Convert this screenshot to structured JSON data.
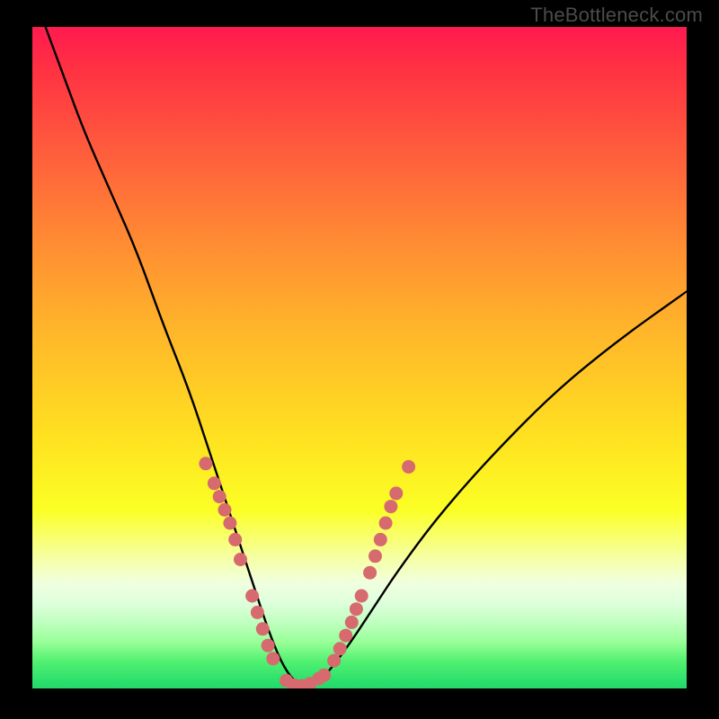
{
  "watermark": "TheBottleneck.com",
  "chart_data": {
    "type": "line",
    "title": "",
    "xlabel": "",
    "ylabel": "",
    "xlim": [
      0,
      100
    ],
    "ylim": [
      0,
      100
    ],
    "grid": false,
    "series": [
      {
        "name": "bottleneck-curve",
        "x": [
          2,
          5,
          8,
          12,
          16,
          20,
          24,
          27,
          30,
          32,
          34,
          36,
          38,
          40,
          42,
          44,
          48,
          52,
          56,
          62,
          70,
          80,
          90,
          100
        ],
        "y": [
          100,
          92,
          84,
          75,
          66,
          55,
          45,
          36,
          27,
          21,
          15,
          9,
          4,
          1,
          0.3,
          1,
          6,
          12,
          18,
          26,
          35,
          45,
          53,
          60
        ]
      }
    ],
    "zone_band": {
      "y_start_pct": 68,
      "y_end_pct": 100
    },
    "dot_clusters": [
      {
        "name": "left-arm-dots",
        "color": "#d66a6f",
        "points": [
          {
            "x": 26.5,
            "y": 34
          },
          {
            "x": 27.8,
            "y": 31
          },
          {
            "x": 28.6,
            "y": 29
          },
          {
            "x": 29.4,
            "y": 27
          },
          {
            "x": 30.2,
            "y": 25
          },
          {
            "x": 31.0,
            "y": 22.5
          },
          {
            "x": 31.8,
            "y": 19.5
          },
          {
            "x": 33.6,
            "y": 14
          },
          {
            "x": 34.4,
            "y": 11.5
          },
          {
            "x": 35.2,
            "y": 9
          },
          {
            "x": 36.0,
            "y": 6.5
          },
          {
            "x": 36.8,
            "y": 4.5
          },
          {
            "x": 38.8,
            "y": 1.2
          },
          {
            "x": 40.0,
            "y": 0.5
          },
          {
            "x": 41.2,
            "y": 0.4
          },
          {
            "x": 42.4,
            "y": 0.7
          },
          {
            "x": 43.8,
            "y": 1.5
          }
        ]
      },
      {
        "name": "right-arm-dots",
        "color": "#d66a6f",
        "points": [
          {
            "x": 44.6,
            "y": 2.0
          },
          {
            "x": 46.1,
            "y": 4.2
          },
          {
            "x": 47.0,
            "y": 6.0
          },
          {
            "x": 47.9,
            "y": 8.0
          },
          {
            "x": 48.8,
            "y": 10.0
          },
          {
            "x": 49.5,
            "y": 12.0
          },
          {
            "x": 50.3,
            "y": 14.0
          },
          {
            "x": 51.6,
            "y": 17.5
          },
          {
            "x": 52.4,
            "y": 20.0
          },
          {
            "x": 53.2,
            "y": 22.5
          },
          {
            "x": 54.0,
            "y": 25.0
          },
          {
            "x": 54.8,
            "y": 27.5
          },
          {
            "x": 55.6,
            "y": 29.5
          },
          {
            "x": 57.5,
            "y": 33.5
          }
        ]
      }
    ]
  }
}
